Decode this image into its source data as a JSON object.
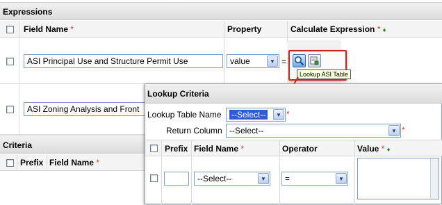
{
  "expressions": {
    "title": "Expressions",
    "columns": {
      "field_name": "Field Name",
      "property": "Property",
      "calculate_expression": "Calculate Expression"
    },
    "rows": [
      {
        "field_value": "ASI Principal Use and Structure Permit  Use",
        "property_value": "value",
        "equals": "="
      },
      {
        "field_value": "ASI Zoning Analysis and Front"
      }
    ],
    "lookup_tooltip": "Lookup ASI Table"
  },
  "criteria": {
    "title": "Criteria",
    "columns": {
      "prefix": "Prefix",
      "field_name": "Field Name"
    }
  },
  "lookup_criteria": {
    "title": "Lookup Criteria",
    "table_name_label": "Lookup Table Name",
    "table_name_value": "--Select--",
    "return_column_label": "Return Column",
    "return_column_value": "--Select--",
    "columns": {
      "prefix": "Prefix",
      "field_name": "Field Name",
      "operator": "Operator",
      "value": "Value"
    },
    "row": {
      "prefix_value": "",
      "field_value": "--Select--",
      "operator_value": "="
    }
  },
  "required_marker": "*",
  "diamond_marker": "♦",
  "colors": {
    "required": "#dd3333",
    "accent_green": "#1e8b22",
    "highlight_red": "#cc2222"
  }
}
